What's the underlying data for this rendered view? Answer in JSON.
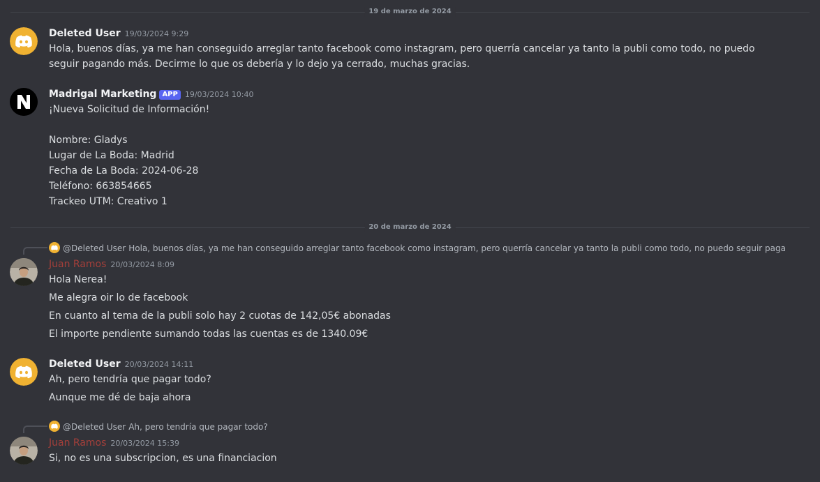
{
  "colors": {
    "background": "#323339",
    "discord_yellow": "#f0b232",
    "app_badge": "#5865f2",
    "juan_name": "#a33f3a"
  },
  "dividers": [
    {
      "text": "19 de marzo de 2024"
    },
    {
      "text": "20 de marzo de 2024"
    }
  ],
  "messages": [
    {
      "author": "Deleted User",
      "avatar_icon": "discord-logo-icon",
      "timestamp": "19/03/2024 9:29",
      "text": "Hola, buenos días, ya me han conseguido arreglar tanto facebook como instagram, pero querría cancelar ya tanto la publi como todo, no puedo seguir pagando más. Decirme lo que os debería y lo dejo ya cerrado, muchas gracias."
    },
    {
      "author": "Madrigal Marketing",
      "avatar_icon": "madrigal-logo-icon",
      "badge": "APP",
      "timestamp": "19/03/2024 10:40",
      "lines": [
        "¡Nueva Solicitud de Información!",
        "Nombre: Gladys",
        "Lugar de La Boda: Madrid",
        "Fecha de La Boda: 2024-06-28",
        "Teléfono: 663854665",
        "Trackeo UTM: Creativo 1"
      ]
    },
    {
      "reply": {
        "mention": "@Deleted User",
        "text": "Hola, buenos días, ya me han conseguido arreglar tanto facebook como instagram, pero querría cancelar ya tanto la publi como todo, no puedo seguir pagan..."
      },
      "author": "Juan Ramos",
      "avatar_icon": "user-photo-avatar",
      "timestamp": "20/03/2024 8:09",
      "lines": [
        "Hola Nerea!",
        "Me alegra oir lo de facebook",
        "En cuanto al tema de la publi solo hay 2 cuotas de 142,05€ abonadas",
        "El importe pendiente sumando todas las cuentas es de 1340.09€"
      ]
    },
    {
      "author": "Deleted User",
      "avatar_icon": "discord-logo-icon",
      "timestamp": "20/03/2024 14:11",
      "lines": [
        "Ah, pero tendría que pagar todo?",
        "Aunque me dé de baja ahora"
      ]
    },
    {
      "reply": {
        "mention": "@Deleted User",
        "text": "Ah, pero tendría que pagar todo?"
      },
      "author": "Juan Ramos",
      "avatar_icon": "user-photo-avatar",
      "timestamp": "20/03/2024 15:39",
      "lines": [
        "Si, no es una subscripcion, es una financiacion"
      ]
    }
  ]
}
